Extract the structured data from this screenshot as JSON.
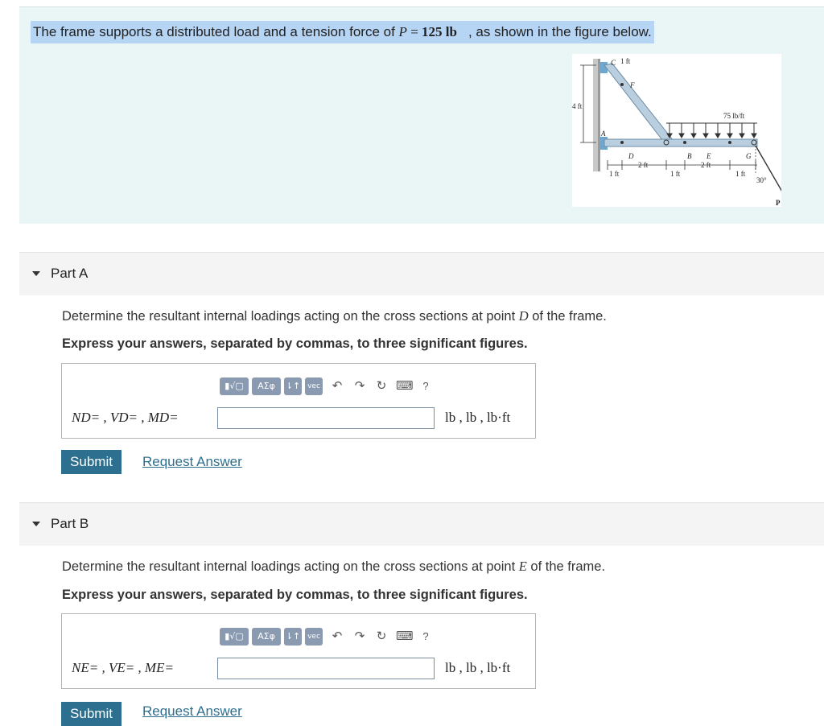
{
  "problem": {
    "text_before": "The frame supports a distributed load and a tension force of ",
    "p_var": "P",
    "p_eq": " = ",
    "p_value": "125 lb",
    "text_after": ", as shown in the figure below."
  },
  "figure": {
    "dim_top": "1 ft",
    "dim_height": "4 ft",
    "load_label": "75 lb/ft",
    "angle_label": "30°",
    "force_label": "P",
    "point_c": "C",
    "point_f": "F",
    "point_a": "A",
    "point_d": "D",
    "point_b": "B",
    "point_e": "E",
    "point_g": "G",
    "dim_1": "1 ft",
    "dim_2": "2 ft",
    "dim_3": "1 ft",
    "dim_4": "2 ft",
    "dim_5": "1 ft"
  },
  "part_a": {
    "title": "Part A",
    "prompt_before": "Determine the resultant internal loadings acting on the cross sections at point ",
    "point": "D",
    "prompt_after": " of the frame.",
    "instruction": "Express your answers, separated by commas, to three significant figures.",
    "var_label": "ND= , VD= , MD=",
    "units": "lb , lb , lb·ft",
    "submit": "Submit",
    "request": "Request Answer"
  },
  "part_b": {
    "title": "Part B",
    "prompt_before": "Determine the resultant internal loadings acting on the cross sections at point ",
    "point": "E",
    "prompt_after": " of the frame.",
    "instruction": "Express your answers, separated by commas, to three significant figures.",
    "var_label": "NE= , VE= , ME=",
    "units": "lb , lb , lb·ft",
    "submit": "Submit",
    "request": "Request Answer"
  },
  "toolbar": {
    "templates": "▮√▢",
    "greek": "ΑΣφ",
    "arrows": "⇂↑",
    "vec": "vec",
    "undo": "↶",
    "redo": "↷",
    "reset": "↻",
    "keyboard": "⌨",
    "help": "?"
  },
  "icons": {
    "caret": "caret-down-icon",
    "undo": "undo-icon",
    "redo": "redo-icon",
    "reset": "reset-icon",
    "keyboard": "keyboard-icon",
    "help": "help-icon"
  },
  "colors": {
    "problem_bg": "#eaf6f5",
    "highlight": "#b6d4f4",
    "button": "#2d6f8e",
    "toolbar_btn": "#8a9ab1",
    "link": "#2d6f8e"
  }
}
